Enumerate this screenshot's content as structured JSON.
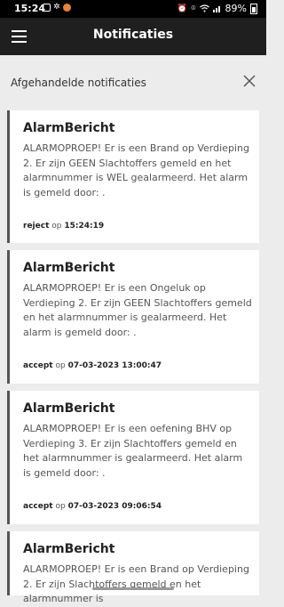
{
  "statusbar": {
    "time": "15:24",
    "battery": "89%"
  },
  "appbar": {
    "title": "Notificaties"
  },
  "section": {
    "label": "Afgehandelde notificaties"
  },
  "notifications": [
    {
      "title": "AlarmBericht",
      "body": "ALARMOPROEP! Er is een Brand op Verdieping 2. Er zijn GEEN Slachtoffers gemeld en het alarmnummer is WEL gealarmeerd. Het alarm is gemeld door: .",
      "status": "reject",
      "op": "op",
      "timestamp": "15:24:19"
    },
    {
      "title": "AlarmBericht",
      "body": "ALARMOPROEP! Er is een Ongeluk op Verdieping 2. Er zijn GEEN Slachtoffers gemeld en het alarmnummer is gealarmeerd. Het alarm is gemeld door: .",
      "status": "accept",
      "op": "op",
      "timestamp": "07-03-2023 13:00:47"
    },
    {
      "title": "AlarmBericht",
      "body": "ALARMOPROEP! Er is een oefening BHV op Verdieping 3. Er zijn Slachtoffers gemeld en het alarmnummer is gealarmeerd. Het alarm is gemeld door: .",
      "status": "accept",
      "op": "op",
      "timestamp": "07-03-2023 09:06:54"
    },
    {
      "title": "AlarmBericht",
      "body": "ALARMOPROEP! Er is een Brand op Verdieping 2. Er zijn Slachtoffers gemeld en het alarmnummer is"
    }
  ]
}
